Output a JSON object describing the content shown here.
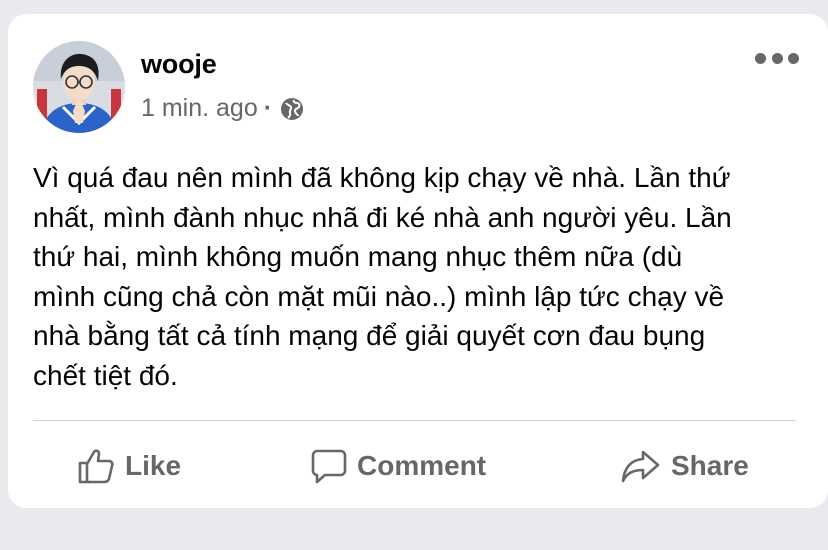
{
  "post": {
    "author": "wooje",
    "timestamp": "1 min. ago",
    "separator": "·",
    "privacy_icon": "globe-icon",
    "more_icon": "more-options-icon",
    "text": "Vì quá đau nên mình đã không kịp chạy về nhà. Lần thứ\nnhất, mình đành nhục nhã đi ké nhà anh người yêu. Lần\nthứ hai, mình không muốn mang nhục thêm nữa (dù\nmình cũng chả còn mặt mũi nào..) mình lập tức chạy về\nnhà bằng tất cả tính mạng để giải quyết cơn đau bụng\nchết tiệt đó."
  },
  "actions": {
    "like_label": "Like",
    "comment_label": "Comment",
    "share_label": "Share"
  },
  "colors": {
    "background": "#e9e9ee",
    "card": "#ffffff",
    "text": "#050505",
    "secondary": "#65676b"
  }
}
